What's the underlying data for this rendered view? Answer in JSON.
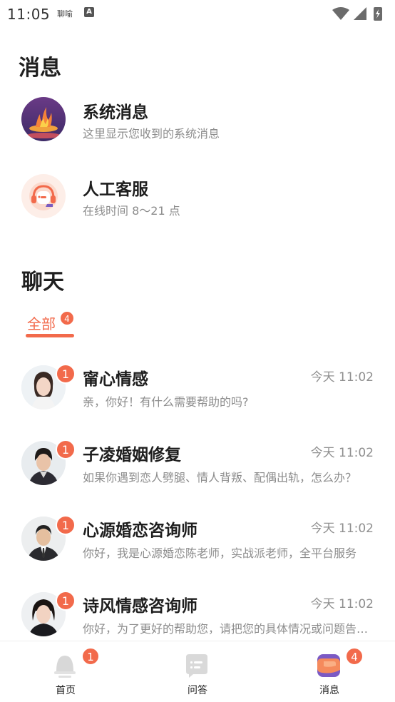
{
  "status_bar": {
    "time": "11:05",
    "carrier": "聊喻",
    "a_badge": "A"
  },
  "messages": {
    "title": "消息",
    "system": {
      "title": "系统消息",
      "subtitle": "这里显示您收到的系统消息",
      "icon": "flame-logo-icon"
    },
    "service": {
      "title": "人工客服",
      "subtitle": "在线时间 8～21 点",
      "icon": "headset-icon"
    }
  },
  "chat": {
    "title": "聊天",
    "tab": {
      "label": "全部",
      "count": "4"
    },
    "items": [
      {
        "name": "甯心情感",
        "time": "今天 11:02",
        "message": "亲，你好！有什么需要帮助的吗?",
        "unread": "1"
      },
      {
        "name": "子凌婚姻修复",
        "time": "今天 11:02",
        "message": "如果你遇到恋人劈腿、情人背叛、配偶出轨，怎么办？",
        "unread": "1"
      },
      {
        "name": "心源婚恋咨询师",
        "time": "今天 11:02",
        "message": "你好，我是心源婚恋陈老师，实战派老师，全平台服务",
        "unread": "1"
      },
      {
        "name": "诗风情感咨询师",
        "time": "今天 11:02",
        "message": "你好，为了更好的帮助您，请把您的具体情况或问题告诉我",
        "unread": "1"
      }
    ]
  },
  "bottom_nav": [
    {
      "label": "首页",
      "icon": "home-bell-icon",
      "badge": "1"
    },
    {
      "label": "问答",
      "icon": "chat-bubble-icon",
      "badge": ""
    },
    {
      "label": "消息",
      "icon": "message-icon",
      "badge": "4"
    }
  ],
  "colors": {
    "accent": "#f26a4b",
    "text": "#1e1e1e",
    "subtext": "#8c8c8c"
  }
}
